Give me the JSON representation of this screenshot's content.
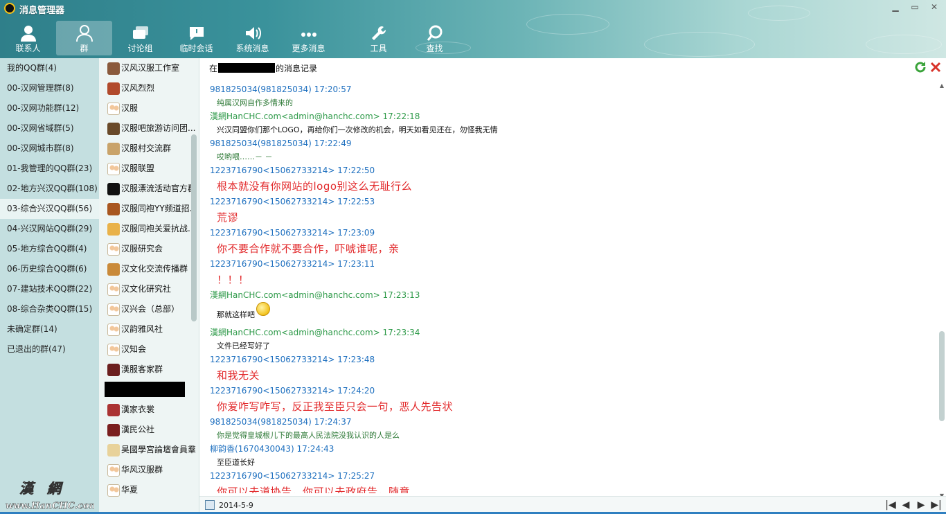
{
  "window": {
    "title": "消息管理器",
    "min": "▁",
    "max": "▭",
    "close": "✕"
  },
  "toolbar": [
    {
      "label": "联系人",
      "icon": "contact-icon"
    },
    {
      "label": "群",
      "icon": "group-icon"
    },
    {
      "label": "讨论组",
      "icon": "discussion-icon"
    },
    {
      "label": "临时会话",
      "icon": "temp-chat-icon"
    },
    {
      "label": "系统消息",
      "icon": "system-message-icon"
    },
    {
      "label": "更多消息",
      "icon": "more-icon"
    },
    {
      "label": "工具",
      "icon": "wrench-icon"
    },
    {
      "label": "查找",
      "icon": "search-icon"
    }
  ],
  "folders": [
    "我的QQ群(4)",
    "00-汉网管理群(8)",
    "00-汉网功能群(12)",
    "00-汉网省域群(5)",
    "00-汉网城市群(8)",
    "01-我管理的QQ群(23)",
    "02-地方兴汉QQ群(108)",
    "03-综合兴汉QQ群(56)",
    "04-兴汉网站QQ群(29)",
    "05-地方综合QQ群(4)",
    "06-历史综合QQ群(6)",
    "07-建站技术QQ群(22)",
    "08-综合杂类QQ群(15)",
    "未确定群(14)",
    "已退出的群(47)"
  ],
  "watermark": {
    "line1": "漢　網",
    "line2": "www.HanCHC.com"
  },
  "groups_top": [
    "汉风汉服工作室",
    "汉风烈烈",
    "汉服",
    "汉服吧旅游访问团...",
    "汉服村交流群",
    "汉服联盟",
    "汉服漂流活动官方群",
    "汉服同袍YY频道招...",
    "汉服同袍关爱抗战...",
    "汉服研究会",
    "汉文化交流传播群",
    "汉文化研究社",
    "汉兴会（总部）",
    "汉韵雅风社",
    "汉知会",
    "漢服客家群"
  ],
  "groups_bottom": [
    "漢家衣裳",
    "漢民公社",
    "昊國學宮論壇會員羣",
    "华风汉服群",
    "华夏"
  ],
  "chat_header": {
    "prefix": "在",
    "suffix": "的消息记录"
  },
  "messages": [
    {
      "header": "981825034(981825034) 17:20:57",
      "hcolor": "blue",
      "body": "纯属汉网自作多情来的",
      "style": "green"
    },
    {
      "header": "漢網HanCHC.com<admin@hanchc.com> 17:22:18",
      "hcolor": "green",
      "body": "兴汉同盟你们那个LOGO，再给你们一次修改的机会，明天如看见还在，勿怪我无情",
      "style": "black"
    },
    {
      "header": "981825034(981825034) 17:22:49",
      "hcolor": "blue",
      "body": "哎哟喂……－ －",
      "style": "green"
    },
    {
      "header": "1223716790<15062733214> 17:22:50",
      "hcolor": "blue",
      "body": "根本就没有你网站的logo别这么无耻行么",
      "style": "big"
    },
    {
      "header": "1223716790<15062733214> 17:22:53",
      "hcolor": "blue",
      "body": "荒谬",
      "style": "big"
    },
    {
      "header": "1223716790<15062733214> 17:23:09",
      "hcolor": "blue",
      "body": "你不要合作就不要合作，吓唬谁呢，亲",
      "style": "big"
    },
    {
      "header": "1223716790<15062733214> 17:23:11",
      "hcolor": "blue",
      "body": "！！！",
      "style": "big"
    },
    {
      "header": "漢網HanCHC.com<admin@hanchc.com> 17:23:13",
      "hcolor": "green",
      "body": "那就这样吧",
      "style": "black",
      "emoji": true
    },
    {
      "header": "漢網HanCHC.com<admin@hanchc.com> 17:23:34",
      "hcolor": "green",
      "body": "文件已经写好了",
      "style": "black"
    },
    {
      "header": "1223716790<15062733214> 17:23:48",
      "hcolor": "blue",
      "body": "和我无关",
      "style": "big"
    },
    {
      "header": "1223716790<15062733214> 17:24:20",
      "hcolor": "blue",
      "body": "你爱咋写咋写，反正我至臣只会一句，恶人先告状",
      "style": "big"
    },
    {
      "header": "981825034(981825034) 17:24:37",
      "hcolor": "blue",
      "body": "你是觉得皇城根儿下的最高人民法院没我认识的人是么",
      "style": "green"
    },
    {
      "header": "柳韵香(1670430043) 17:24:43",
      "hcolor": "blue",
      "body": "至臣道长好",
      "style": "black"
    },
    {
      "header": "1223716790<15062733214> 17:25:27",
      "hcolor": "blue",
      "body": "你可以去道协告，你可以去政府告，随意",
      "style": "big"
    }
  ],
  "footer": {
    "date": "2014-5-9",
    "first": "|◀",
    "prev": "◀",
    "next": "▶",
    "last": "▶|"
  }
}
